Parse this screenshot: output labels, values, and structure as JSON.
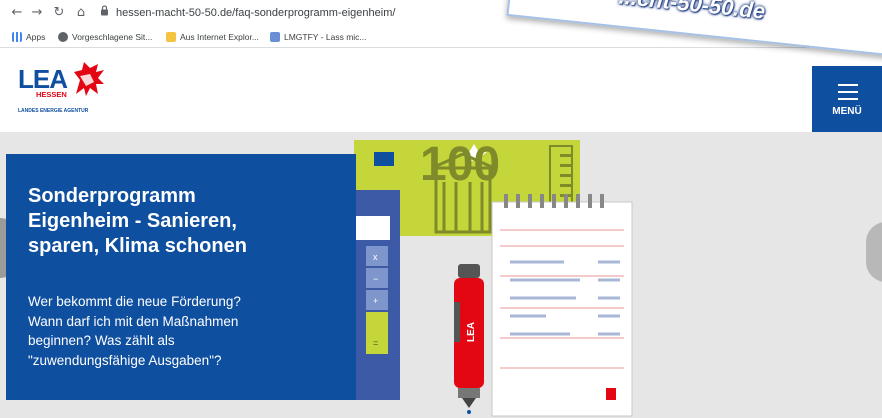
{
  "browser": {
    "url": "hessen-macht-50-50.de/faq-sonderprogramm-eigenheim/",
    "bookmarks": [
      "Apps",
      "Vorgeschlagene Sit...",
      "Aus Internet Explor...",
      "LMGTFY - Lass mic..."
    ]
  },
  "header": {
    "logo_text": "LEA",
    "logo_sub": "HESSEN",
    "logo_tagline": "LANDES ENERGIE AGENTUR",
    "menu_label": "MENÜ"
  },
  "hero": {
    "title": "Sonderprogramm\nEigenheim - Sanieren,\nsparen, Klima schonen",
    "text": "Wer bekommt die neue Förderung?\nWann darf ich mit den Maßnahmen\nbeginnen? Was zählt als\n\"zuwendungsfähige Ausgaben\"?"
  },
  "illustration": {
    "banknote_value": "100",
    "calc_keys": [
      "x",
      "−",
      "+",
      "="
    ],
    "pen_label": "LEA"
  },
  "overlay": {
    "text": "...cht-50-50.de"
  },
  "colors": {
    "brand_blue": "#0f4fa0",
    "lea_red": "#e30613",
    "banknote_green": "#c5d63b",
    "background": "#e6e6e6"
  }
}
